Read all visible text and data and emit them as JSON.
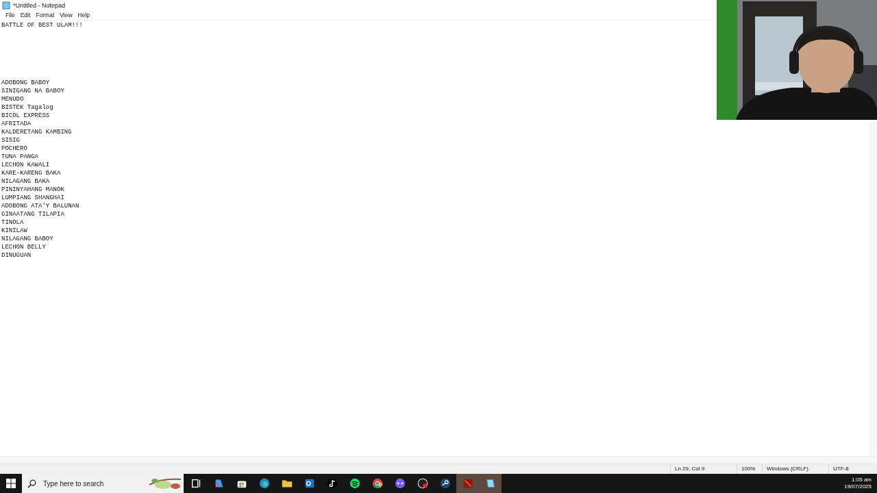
{
  "window": {
    "title": "*Untitled - Notepad"
  },
  "menu": [
    "File",
    "Edit",
    "Format",
    "View",
    "Help"
  ],
  "document": {
    "heading": "BATTLE OF BEST ULAM!!!",
    "lines": [
      "ADOBONG BABOY",
      "SINIGANG NA BABOY",
      "MENUDO",
      "BISTEK Tagalog",
      "BICOL EXPRESS",
      "AFRITADA",
      "KALDERETANG KAMBING",
      "SISIG",
      "POCHERO",
      "TUNA PANGA",
      "LECHON KAWALI",
      "KARE-KARENG BAKA",
      "NILAGANG BAKA",
      "PININYAHANG MANOK",
      "LUMPIANG SHANGHAI",
      "ADOBONG ATA'Y BALUNAN",
      "GINAATANG TILAPIA",
      "TINOLA",
      "KINILAW",
      "NILAGANG BABOY",
      "LECHON BELLY",
      "DINUGUAN"
    ]
  },
  "status_bar": {
    "position": "Ln 29, Col 9",
    "zoom": "100%",
    "line_ending": "Windows (CRLF)",
    "encoding": "UTF-8"
  },
  "taskbar": {
    "search": {
      "placeholder": "Type here to search"
    },
    "apps": [
      {
        "kind": "taskview",
        "active": false
      },
      {
        "kind": "copilot",
        "active": false
      },
      {
        "kind": "store",
        "active": false
      },
      {
        "kind": "edge",
        "active": false
      },
      {
        "kind": "folder",
        "active": false
      },
      {
        "kind": "outlook",
        "active": false
      },
      {
        "kind": "note",
        "active": false
      },
      {
        "kind": "spotify",
        "active": false
      },
      {
        "kind": "chrome",
        "active": false
      },
      {
        "kind": "chat",
        "active": false
      },
      {
        "kind": "record",
        "active": false
      },
      {
        "kind": "steam",
        "active": false
      },
      {
        "kind": "game",
        "active": true
      },
      {
        "kind": "notepad",
        "active": true
      }
    ],
    "time": "1:05 am",
    "date": "19/07/2025"
  }
}
